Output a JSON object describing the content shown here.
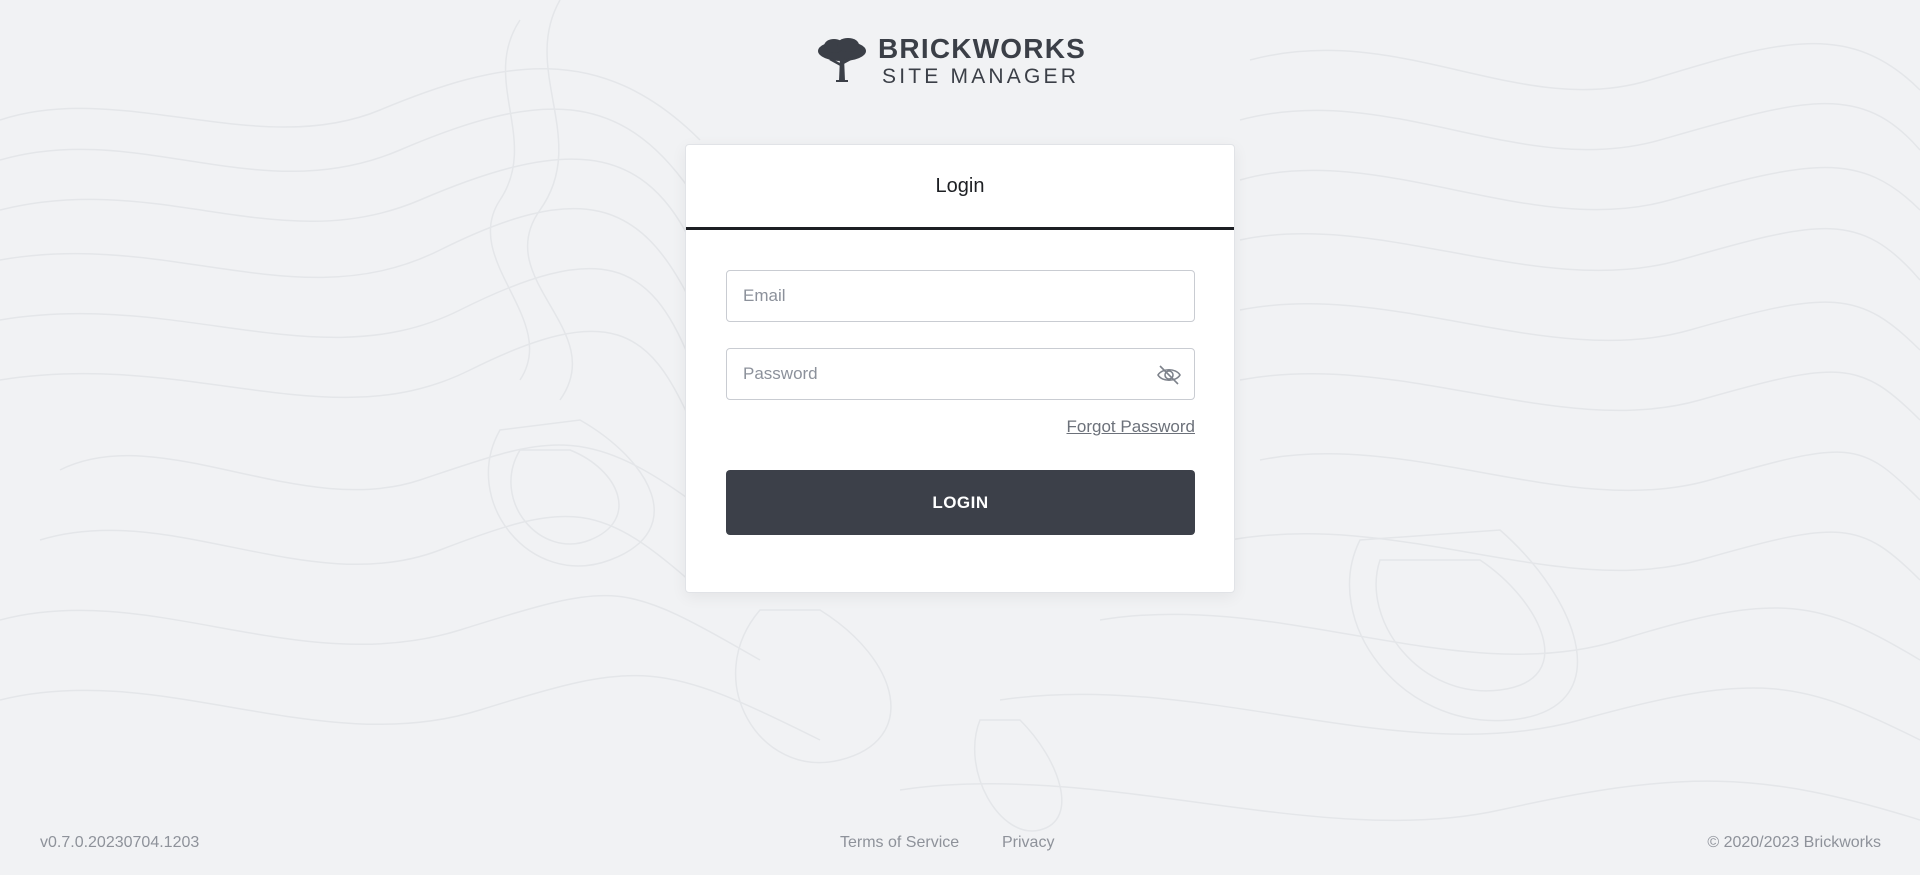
{
  "brand": {
    "name": "BRICKWORKS",
    "subtitle": "SITE MANAGER",
    "logo_icon": "tree-icon"
  },
  "login_card": {
    "title": "Login",
    "email": {
      "placeholder": "Email",
      "value": ""
    },
    "password": {
      "placeholder": "Password",
      "value": "",
      "toggle_icon": "eye-off-icon"
    },
    "forgot_label": "Forgot Password",
    "submit_label": "LOGIN"
  },
  "footer": {
    "version": "v0.7.0.20230704.1203",
    "links": {
      "terms": "Terms of Service",
      "privacy": "Privacy"
    },
    "copyright": "© 2020/2023  Brickworks"
  },
  "colors": {
    "background": "#f1f2f4",
    "primary_button": "#3c4049",
    "text_dark": "#1d1f23",
    "footer_text": "#8e929a"
  }
}
